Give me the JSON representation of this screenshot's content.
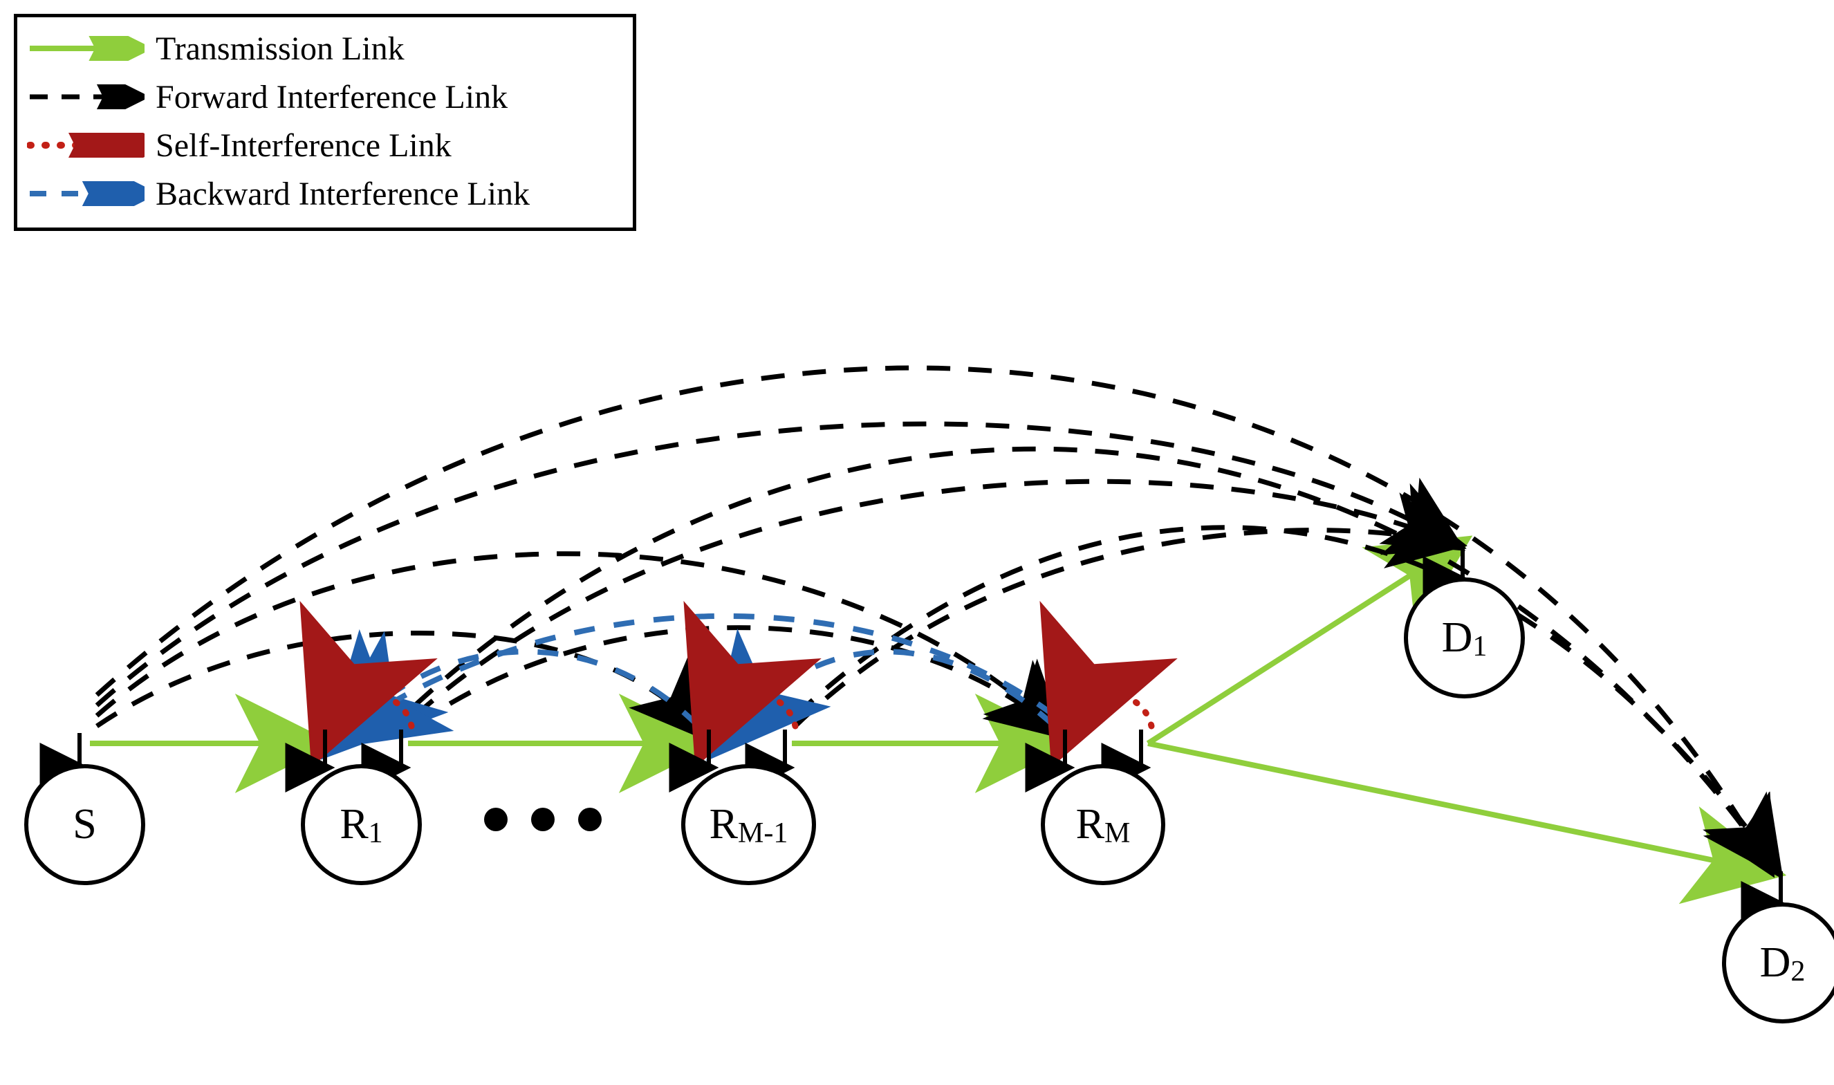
{
  "domain": "Diagram",
  "legend": {
    "items": [
      {
        "label": "Transmission Link",
        "style": "transmission"
      },
      {
        "label": "Forward Interference Link",
        "style": "forward"
      },
      {
        "label": "Self-Interference Link",
        "style": "self"
      },
      {
        "label": "Backward Interference Link",
        "style": "backward"
      }
    ]
  },
  "colors": {
    "transmission": "#8fce3c",
    "forward": "#000000",
    "self_dot": "#c22016",
    "self_arrow": "#a31818",
    "backward": "#2f6db3",
    "backward_arrow": "#1f5fad",
    "node_stroke": "#000000"
  },
  "nodes": {
    "S": {
      "label": "S",
      "sub": ""
    },
    "R1": {
      "label": "R",
      "sub": "1"
    },
    "RMm1": {
      "label": "R",
      "sub": "M-1"
    },
    "RM": {
      "label": "R",
      "sub": "M"
    },
    "D1": {
      "label": "D",
      "sub": "1"
    },
    "D2": {
      "label": "D",
      "sub": "2"
    }
  },
  "ellipsis_glyph": "•••",
  "diagram_description": "Multi-hop full-duplex relay network: source S transmits through relays R1 … R(M-1), RM to destinations D1 and D2. Green solid lines are desired transmission links along the chain and from RM to D1, D2. Black dashed arcs are forward interference links (from earlier nodes to later relays and to destinations). Red dotted short loops at each relay represent self-interference. Blue dashed arcs between neighboring relays represent backward interference."
}
